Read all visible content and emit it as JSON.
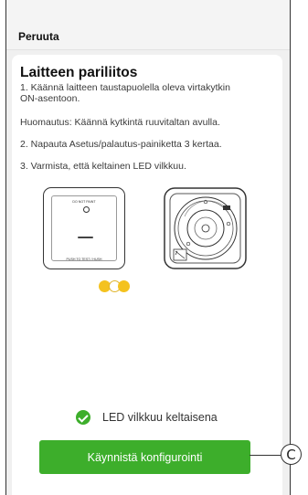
{
  "header": {
    "cancel_label": "Peruuta"
  },
  "card": {
    "title": "Laitteen pariliitos",
    "steps": [
      "1. Käännä laitteen taustapuolella oleva virtakytkin ON-asentoon.",
      "Huomautus: Käännä kytkintä ruuvitaltan avulla.",
      "2. Napauta Asetus/palautus-painiketta 3 kertaa.",
      "3. Varmista, että keltainen LED vilkkuu."
    ],
    "device_front": {
      "label_top": "DO NOT PAINT",
      "label_bottom": "PUSH TO TEST / HUSH"
    }
  },
  "status": {
    "text": "LED vilkkuu keltaisena",
    "icon": "check-circle-icon",
    "color": "#3dae2b"
  },
  "primary_action": {
    "label": "Käynnistä konfigurointi",
    "color": "#3dae2b"
  },
  "callout": {
    "letter": "C"
  },
  "led_color": "#f4c21f"
}
